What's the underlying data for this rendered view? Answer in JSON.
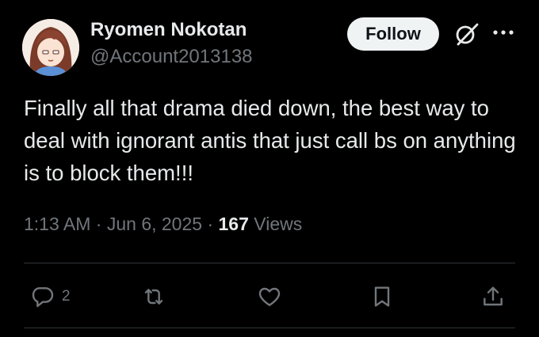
{
  "author": {
    "display_name": "Ryomen Nokotan",
    "handle": "@Account2013138"
  },
  "header": {
    "follow_label": "Follow",
    "grok_icon": "grok-icon",
    "more_icon": "more-icon"
  },
  "tweet": {
    "text": "Finally all that drama died down, the best way to deal with ignorant antis that just call bs on anything is to block them!!!",
    "time": "1:13 AM",
    "separator": " · ",
    "date": "Jun 6, 2025",
    "views_count": "167",
    "views_label": "Views"
  },
  "actions": {
    "reply_count": "2",
    "reply_icon": "reply-icon",
    "retweet_icon": "retweet-icon",
    "like_icon": "heart-icon",
    "bookmark_icon": "bookmark-icon",
    "share_icon": "share-icon"
  },
  "colors": {
    "background": "#000000",
    "primary_text": "#e7e9ea",
    "secondary_text": "#71767b",
    "divider": "#2f3336",
    "follow_bg": "#eff3f4"
  }
}
